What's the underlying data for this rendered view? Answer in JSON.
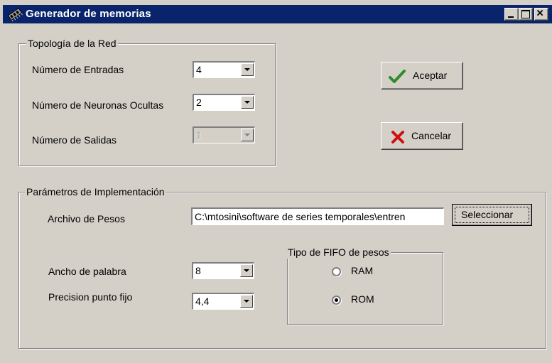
{
  "window": {
    "title": "Generador de memorias",
    "icon": "app-icon",
    "title_bar_color": "#09246b",
    "face_color": "#d4d0c8",
    "caption_buttons": [
      "minimize",
      "maximize",
      "close"
    ]
  },
  "topologia": {
    "legend": "Topología de la Red",
    "entradas": {
      "label": "Número de Entradas",
      "value": "4"
    },
    "ocultas": {
      "label": "Número de Neuronas Ocultas",
      "value": "2"
    },
    "salidas": {
      "label": "Número de Salidas",
      "value": "1",
      "disabled": true
    }
  },
  "actions": {
    "aceptar": {
      "label": "Aceptar",
      "icon": "checkmark-icon",
      "icon_color": "#2e8b2e"
    },
    "cancelar": {
      "label": "Cancelar",
      "icon": "x-icon",
      "icon_color": "#d01010"
    }
  },
  "parametros": {
    "legend": "Parámetros de Implementación",
    "archivo": {
      "label": "Archivo de Pesos",
      "value": "C:\\mtosini\\software de series temporales\\entren",
      "button_label": "Seleccionar"
    },
    "ancho": {
      "label": "Ancho de palabra",
      "value": "8"
    },
    "precision": {
      "label": "Precision punto fijo",
      "value": "4,4"
    },
    "fifo": {
      "legend": "Tipo de FIFO de pesos",
      "options": [
        {
          "label": "RAM",
          "checked": false
        },
        {
          "label": "ROM",
          "checked": true
        }
      ]
    }
  }
}
